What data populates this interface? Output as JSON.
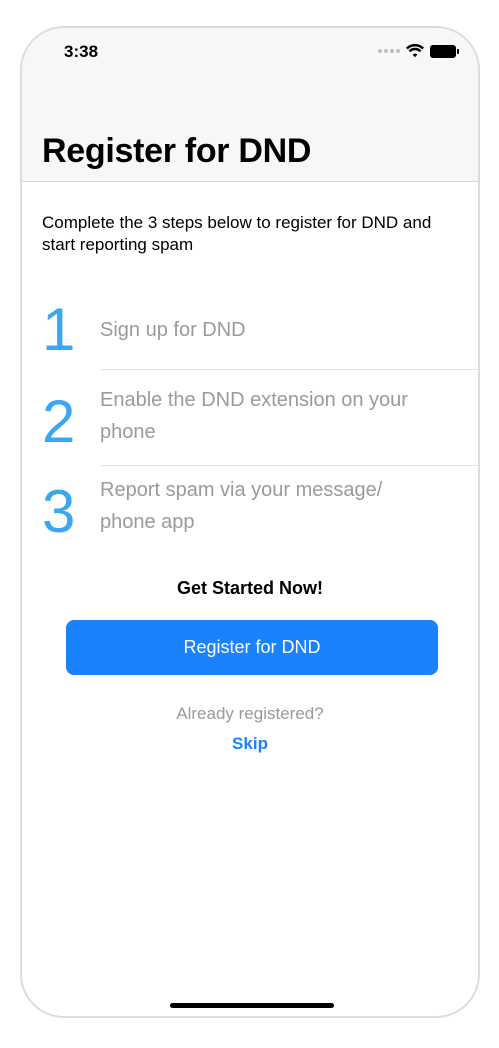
{
  "status_bar": {
    "time": "3:38",
    "icons": [
      "signal-dots-icon",
      "wifi-icon",
      "battery-icon"
    ]
  },
  "header": {
    "title": "Register for DND"
  },
  "intro": {
    "text": "Complete the 3 steps below to register for DND and start reporting spam"
  },
  "steps": [
    {
      "number": "1",
      "text": "Sign up for DND"
    },
    {
      "number": "2",
      "text": "Enable the DND extension on your phone"
    },
    {
      "number": "3",
      "text": "Report spam via your message/ phone app"
    }
  ],
  "cta": {
    "heading": "Get Started Now!",
    "register_label": "Register for DND",
    "already_text": "Already registered?",
    "skip_label": "Skip"
  },
  "colors": {
    "accent_blue": "#1a82fb",
    "step_number_blue": "#3aa7f0",
    "muted_text": "#9a9a9a"
  }
}
